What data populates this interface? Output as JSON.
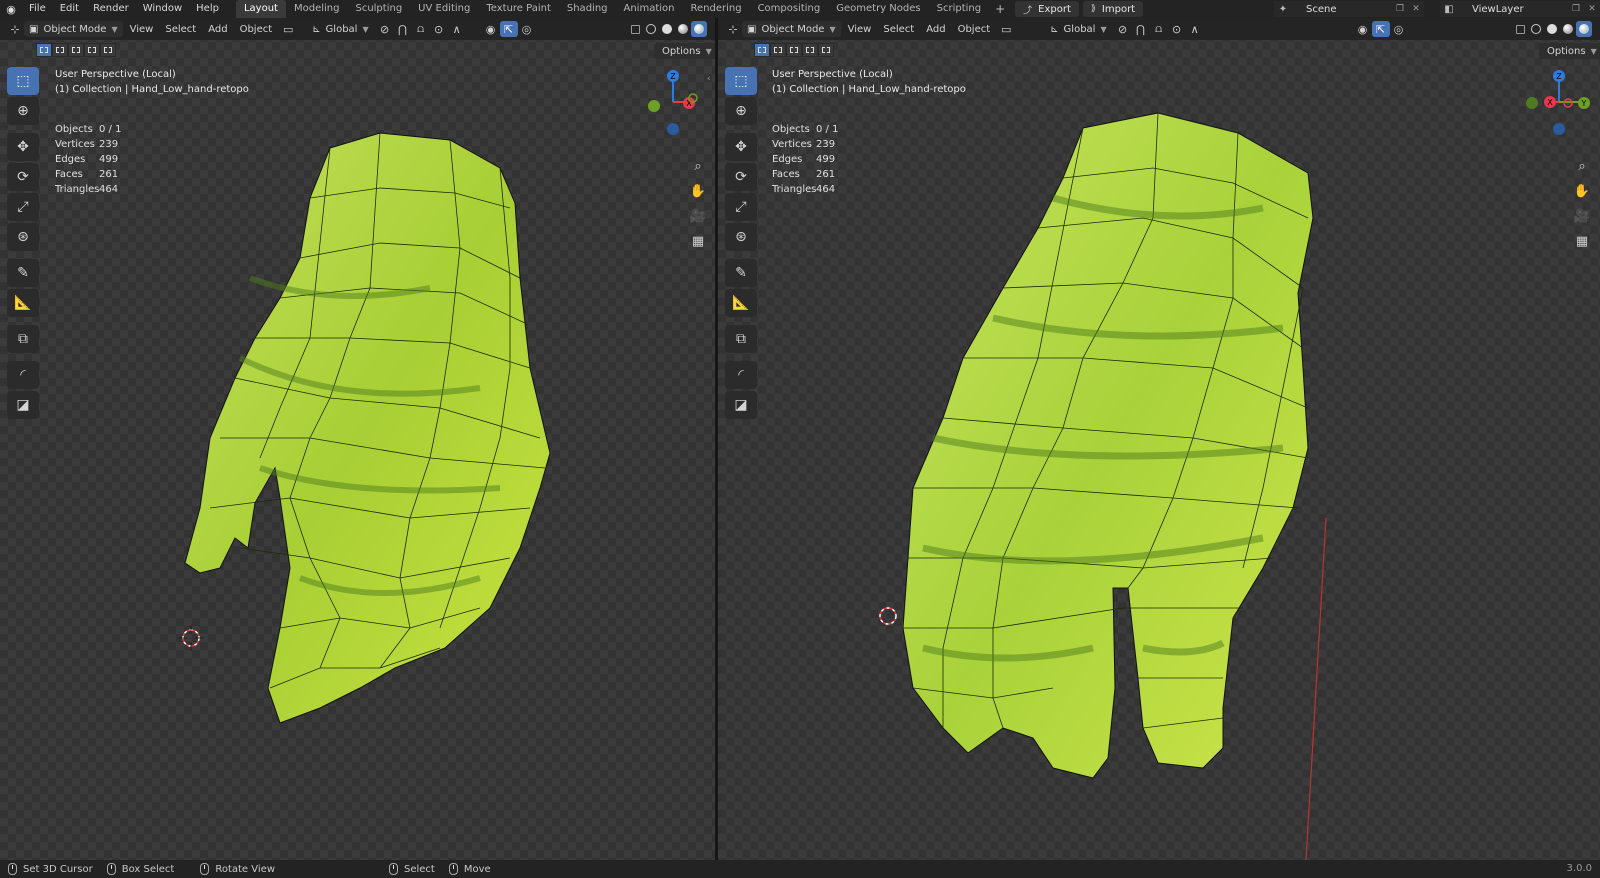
{
  "menu": [
    "File",
    "Edit",
    "Render",
    "Window",
    "Help"
  ],
  "workspaces": [
    "Layout",
    "Modeling",
    "Sculpting",
    "UV Editing",
    "Texture Paint",
    "Shading",
    "Animation",
    "Rendering",
    "Compositing",
    "Geometry Nodes",
    "Scripting"
  ],
  "active_workspace": "Layout",
  "add_workspace": "+",
  "export_label": "Export",
  "import_label": "Import",
  "scene_name": "Scene",
  "view_layer_name": "ViewLayer",
  "viewport_header": {
    "mode": "Object Mode",
    "view": "View",
    "select": "Select",
    "add": "Add",
    "object": "Object",
    "transform_orientation": "Global",
    "options": "Options"
  },
  "overlay": {
    "perspective": "User Perspective (Local)",
    "collection": "(1) Collection | Hand_Low_hand-retopo"
  },
  "stats": [
    {
      "label": "Objects",
      "value": "0 / 1"
    },
    {
      "label": "Vertices",
      "value": "239"
    },
    {
      "label": "Edges",
      "value": "499"
    },
    {
      "label": "Faces",
      "value": "261"
    },
    {
      "label": "Triangles",
      "value": "464"
    }
  ],
  "gizmo_axes": {
    "z": "Z",
    "x": "X",
    "y": "Y"
  },
  "colors": {
    "accent": "#4772b3",
    "x_axis": "#e8384f",
    "y_axis": "#6ea023",
    "z_axis": "#2d7de1",
    "mesh": "#b3d83a"
  },
  "statusbar": {
    "set_cursor": "Set 3D Cursor",
    "box_select": "Box Select",
    "rotate_view": "Rotate View",
    "select": "Select",
    "move": "Move",
    "version": "3.0.0"
  }
}
